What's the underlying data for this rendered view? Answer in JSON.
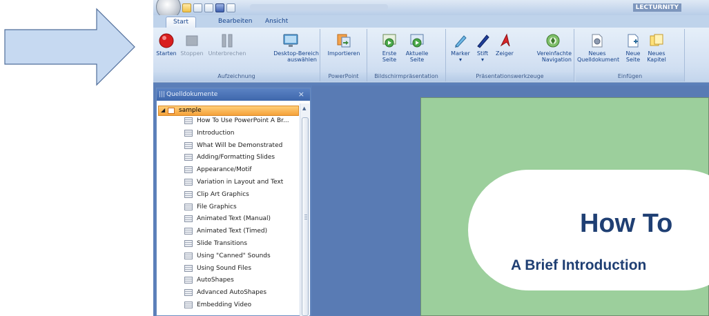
{
  "titlebar": {
    "app_name": "LECTURNITY"
  },
  "ribbon": {
    "tabs": [
      "Start",
      "Bearbeiten",
      "Ansicht"
    ],
    "groups": {
      "aufzeichnung": {
        "label": "Aufzeichnung",
        "starten": "Starten",
        "stoppen": "Stoppen",
        "unterbrechen": "Unterbrechen",
        "desktop_line1": "Desktop-Bereich",
        "desktop_line2": "auswählen"
      },
      "powerpoint": {
        "label": "PowerPoint",
        "importieren": "Importieren"
      },
      "bildschirm": {
        "label": "Bildschirmpräsentation",
        "erste_line1": "Erste",
        "erste_line2": "Seite",
        "aktuelle_line1": "Aktuelle",
        "aktuelle_line2": "Seite"
      },
      "werkzeuge": {
        "label": "Präsentationswerkzeuge",
        "marker": "Marker",
        "stift": "Stift",
        "zeiger": "Zeiger",
        "navigation_line1": "Vereinfachte",
        "navigation_line2": "Navigation"
      },
      "einfuegen": {
        "label": "Einfügen",
        "quelldokument_line1": "Neues",
        "quelldokument_line2": "Quelldokument",
        "seite_line1": "Neue",
        "seite_line2": "Seite",
        "kapitel_line1": "Neues",
        "kapitel_line2": "Kapitel"
      }
    }
  },
  "panel": {
    "title": "Quelldokumente",
    "close": "×",
    "root": "sample",
    "slides": [
      "How To Use PowerPoint A Br...",
      "Introduction",
      "What Will be Demonstrated",
      "Adding/Formatting Slides",
      "Appearance/Motif",
      "Variation in Layout and Text",
      "Clip Art Graphics",
      "File Graphics",
      "Animated Text (Manual)",
      "Animated Text (Timed)",
      "Slide Transitions",
      "Using \"Canned\" Sounds",
      "Using Sound Files",
      "AutoShapes",
      "Advanced AutoShapes",
      "Embedding Video"
    ]
  },
  "slide": {
    "title": "How To",
    "subtitle": "A Brief Introduction"
  },
  "colors": {
    "ribbon_text": "#15428b",
    "slide_background": "#9ccf9c",
    "slide_text": "#1f3f73",
    "workspace": "#597bb4",
    "selection": "#f5a13a"
  }
}
